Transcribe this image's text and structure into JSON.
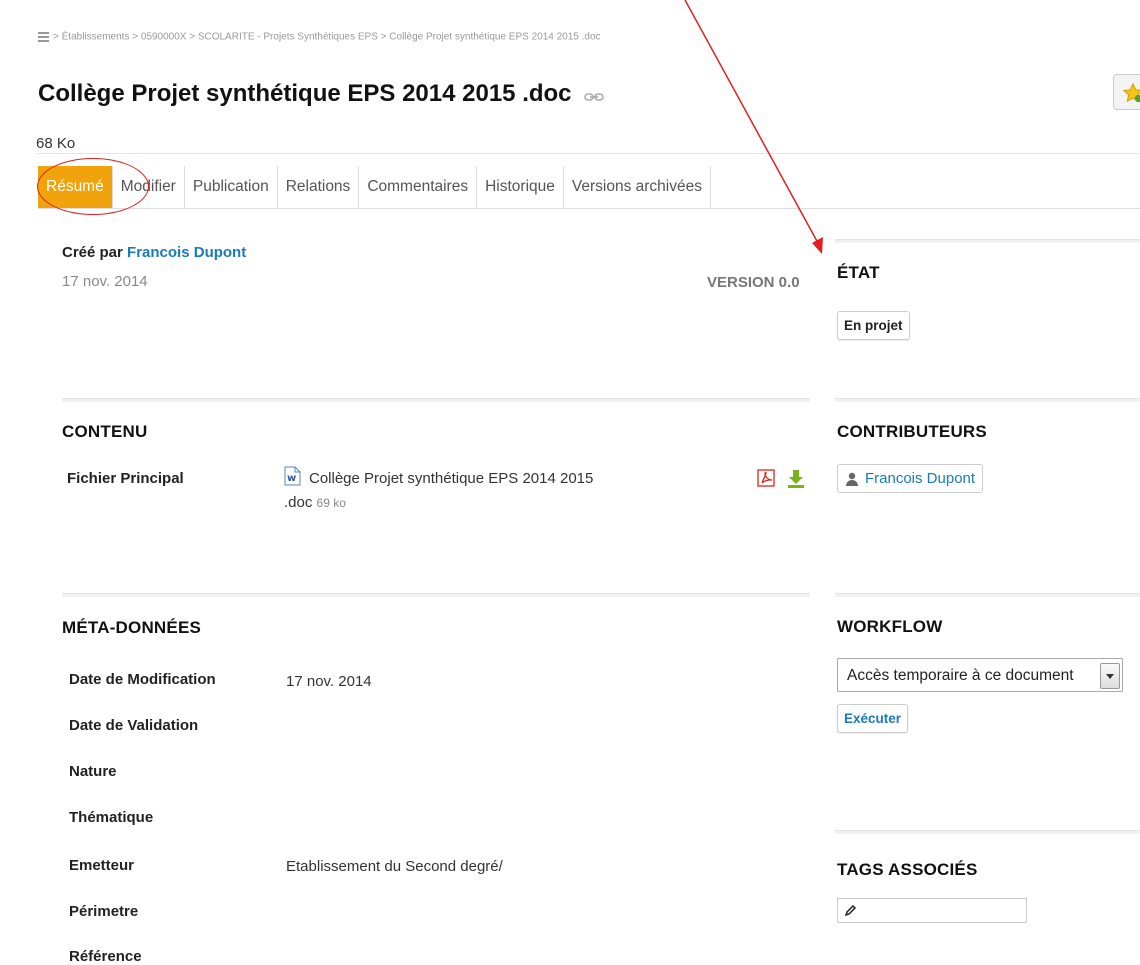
{
  "breadcrumb": "> Établissements > 0590000X > SCOLARITE - Projets Synthétiques EPS > Collège Projet synthétique EPS 2014 2015 .doc",
  "page": {
    "title": "Collège Projet synthétique EPS 2014 2015 .doc",
    "size": "68 Ko"
  },
  "tabs": [
    {
      "label": "Résumé",
      "active": true
    },
    {
      "label": "Modifier"
    },
    {
      "label": "Publication"
    },
    {
      "label": "Relations"
    },
    {
      "label": "Commentaires"
    },
    {
      "label": "Historique"
    },
    {
      "label": "Versions archivées"
    }
  ],
  "summary": {
    "created_by_prefix": "Créé par",
    "author": "Francois Dupont",
    "date": "17 nov. 2014",
    "version": "VERSION 0.0"
  },
  "content": {
    "title": "CONTENU",
    "main_file_label": "Fichier Principal",
    "file_name_line1": "Collège Projet synthétique EPS 2014 2015",
    "file_name_line2": ".doc",
    "file_size": "69 ko"
  },
  "metadata": {
    "title": "MÉTA-DONNÉES",
    "rows": [
      {
        "label": "Date de Modification",
        "value": "17 nov. 2014"
      },
      {
        "label": "Date de Validation",
        "value": ""
      },
      {
        "label": "Nature",
        "value": ""
      },
      {
        "label": "Thématique",
        "value": ""
      },
      {
        "label": "Emetteur",
        "value": "Etablissement du Second degré/"
      },
      {
        "label": "Périmetre",
        "value": ""
      },
      {
        "label": "Référence",
        "value": ""
      }
    ]
  },
  "state": {
    "title": "ÉTAT",
    "value": "En projet"
  },
  "contributors": {
    "title": "CONTRIBUTEURS",
    "items": [
      "Francois Dupont"
    ]
  },
  "workflow": {
    "title": "WORKFLOW",
    "selected": "Accès temporaire à ce document",
    "execute_label": "Exécuter"
  },
  "tags": {
    "title": "TAGS ASSOCIÉS"
  },
  "colors": {
    "active_tab": "#f0a30a",
    "link": "#1a7bb8",
    "annotation": "#e02020",
    "download_icon": "#7ab317",
    "pdf_icon": "#d9261c"
  },
  "icons": [
    "menu-icon",
    "link-icon",
    "favorite-star-icon",
    "word-doc-icon",
    "pdf-icon",
    "download-icon",
    "user-icon",
    "pencil-icon"
  ]
}
